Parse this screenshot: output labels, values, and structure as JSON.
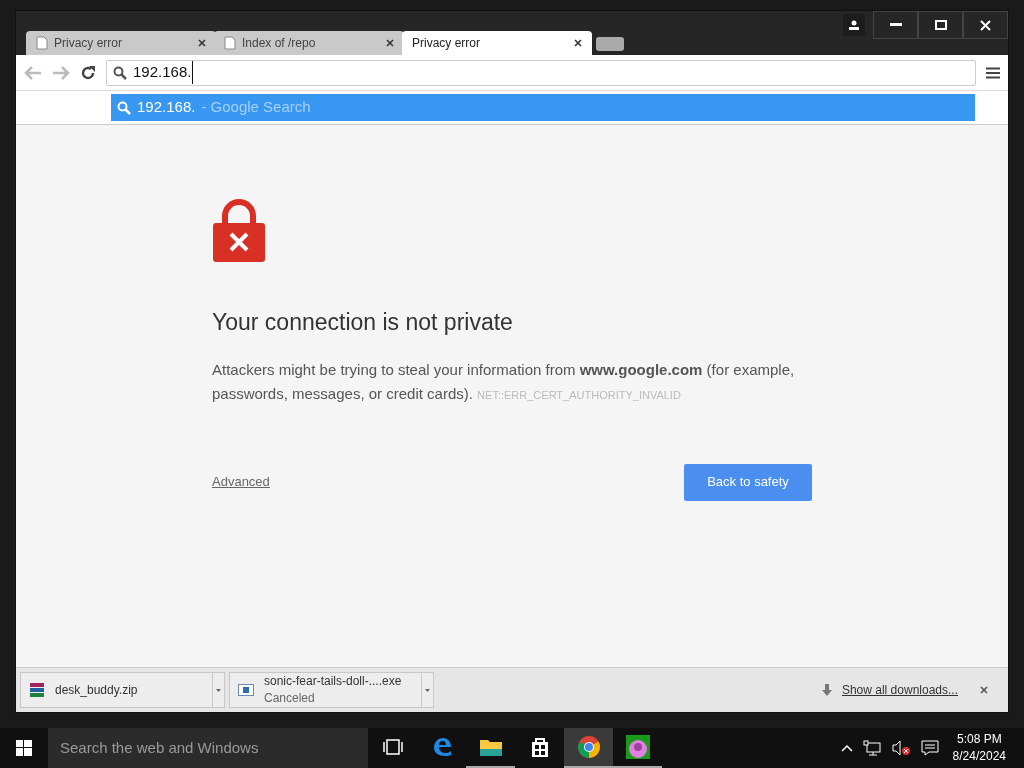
{
  "tabs": [
    {
      "title": "Privacy error",
      "selected": false
    },
    {
      "title": "Index of /repo",
      "selected": false
    },
    {
      "title": "Privacy error",
      "selected": true
    }
  ],
  "omnibox": {
    "value": "192.168."
  },
  "suggestions": [
    {
      "query": "192.168.",
      "suffix": "- Google Search",
      "selected": true
    }
  ],
  "error": {
    "title": "Your connection is not private",
    "message": "Attackers might be trying to steal your information from **www.google.com** (for example, passwords, messages, or credit cards).",
    "code": "NET::ERR_CERT_AUTHORITY_INVALID",
    "advanced_link": "Advanced",
    "primary_button": "Back to safety"
  },
  "downloads": [
    {
      "kind": "archive",
      "filename": "desk_buddy.zip"
    },
    {
      "kind": "program",
      "filename": "sonic-fear-tails-doll-....exe",
      "status": "Canceled"
    }
  ],
  "show_all": "Show all downloads...",
  "taskbar": {
    "search_placeholder": "Search the web and Windows",
    "apps": [
      {
        "kind": "task-view",
        "running": false,
        "selected": false
      },
      {
        "kind": "edge",
        "running": false,
        "selected": false
      },
      {
        "kind": "explorer",
        "running": true,
        "selected": false
      },
      {
        "kind": "store",
        "running": false,
        "selected": false
      },
      {
        "kind": "chrome",
        "running": true,
        "selected": true
      },
      {
        "kind": "game",
        "running": true,
        "selected": false
      }
    ],
    "sound_muted": true,
    "time": "5:08 PM",
    "date": "8/24/2024"
  }
}
